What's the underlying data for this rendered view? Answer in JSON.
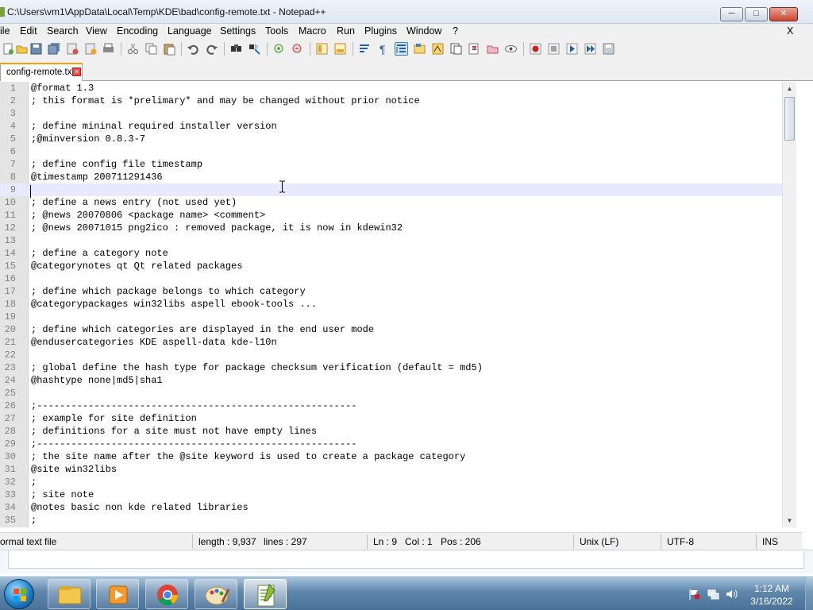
{
  "window": {
    "title": "C:\\Users\\vm1\\AppData\\Local\\Temp\\KDE\\bad\\config-remote.txt - Notepad++",
    "minimize_icon": "minimize-icon",
    "maximize_icon": "maximize-icon",
    "close_icon": "close-icon"
  },
  "menu": {
    "items": [
      "ile",
      "Edit",
      "Search",
      "View",
      "Encoding",
      "Language",
      "Settings",
      "Tools",
      "Macro",
      "Run",
      "Plugins",
      "Window",
      "?"
    ],
    "close_label": "X"
  },
  "toolbar": {
    "buttons": [
      "new-file-icon",
      "open-file-icon",
      "save-icon",
      "save-all-icon",
      "close-icon",
      "close-all-icon",
      "print-icon",
      "cut-icon",
      "copy-icon",
      "paste-icon",
      "undo-icon",
      "redo-icon",
      "find-icon",
      "replace-icon",
      "zoom-in-icon",
      "zoom-out-icon",
      "sync-vertical-icon",
      "sync-horizontal-icon",
      "word-wrap-icon",
      "show-all-characters-icon",
      "indent-guide-icon",
      "user-language-icon",
      "doc-map-icon",
      "function-list-icon",
      "folder-workspace-icon",
      "monitoring-icon",
      "eye-icon",
      "record-macro-icon",
      "stop-macro-icon",
      "play-macro-icon",
      "run-macro-multiple-icon",
      "save-macro-icon"
    ],
    "pressed": "indent-guide-icon"
  },
  "tabs": [
    {
      "label": "config-remote.txt",
      "icon": "file-saved-icon",
      "close_icon": "tab-close-icon"
    }
  ],
  "editor": {
    "current_line": 9,
    "lines": [
      "@format 1.3",
      "; this format is *prelimary* and may be changed without prior notice",
      "",
      "; define mininal required installer version",
      ";@minversion 0.8.3-7",
      "",
      "; define config file timestamp",
      "@timestamp 200711291436",
      "",
      "; define a news entry (not used yet)",
      "; @news 20070806 <package name> <comment>",
      "; @news 20071015 png2ico : removed package, it is now in kdewin32",
      "",
      "; define a category note",
      "@categorynotes qt Qt related packages",
      "",
      "; define which package belongs to which category",
      "@categorypackages win32libs aspell ebook-tools ...",
      "",
      "; define which categories are displayed in the end user mode",
      "@endusercategories KDE aspell-data kde-l10n",
      "",
      "; global define the hash type for package checksum verification (default = md5)",
      "@hashtype none|md5|sha1",
      "",
      ";--------------------------------------------------------",
      "; example for site definition",
      "; definitions for a site must not have empty lines",
      ";--------------------------------------------------------",
      "; the site name after the @site keyword is used to create a package category",
      "@site win32libs",
      ";",
      "; site note",
      "@notes basic non kde related libraries",
      ";"
    ]
  },
  "statusbar": {
    "file_type": "ormal text file",
    "length": "length : 9,937",
    "lines": "lines : 297",
    "ln": "Ln : 9",
    "col": "Col : 1",
    "pos": "Pos : 206",
    "eol": "Unix (LF)",
    "encoding": "UTF-8",
    "mode": "INS"
  },
  "taskbar": {
    "start_icon": "windows-start-icon",
    "apps": [
      "file-explorer-icon",
      "media-player-icon",
      "chrome-icon",
      "paint-icon",
      "notepad-plus-plus-icon"
    ],
    "active_app": "notepad-plus-plus-icon",
    "tray": [
      "action-center-flag-icon",
      "network-icon",
      "volume-icon"
    ],
    "time": "1:12 AM",
    "date": "3/16/2022"
  },
  "colors": {
    "current_line_bg": "#e8e8ff",
    "gutter_bg": "#e4e4e4",
    "tab_accent": "#f6a200",
    "taskbar": "#5f86ab"
  }
}
